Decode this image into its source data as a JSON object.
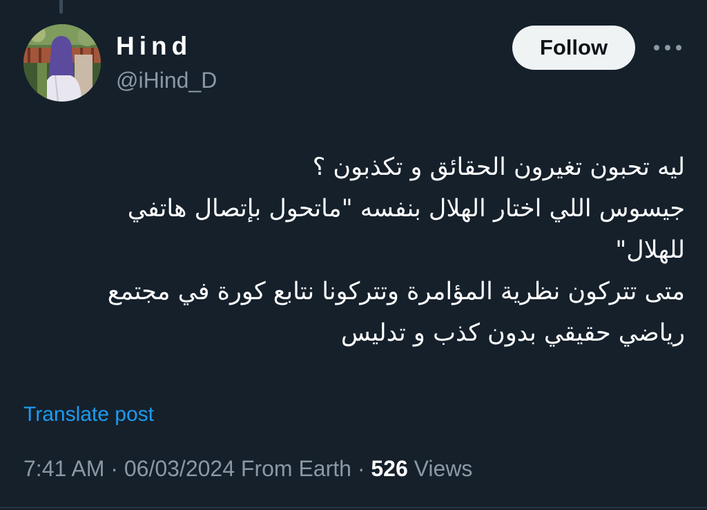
{
  "colors": {
    "background": "#15202b",
    "primary_text": "#ffffff",
    "secondary_text": "#8b98a5",
    "link": "#1d9bf0",
    "follow_button_bg": "#eff3f4",
    "follow_button_text": "#0f1419"
  },
  "author": {
    "display_name": "Hind",
    "handle": "@iHind_D",
    "avatar_icon": "profile-photo"
  },
  "actions": {
    "follow_label": "Follow",
    "more_icon": "more-horizontal-icon"
  },
  "post": {
    "lines": [
      "ليه تحبون تغيرون الحقائق و تكذبون ؟",
      "جيسوس اللي اختار الهلال بنفسه \"ماتحول بإتصال هاتفي",
      "للهلال\"",
      "متى تتركون نظرية المؤامرة وتتركونا نتابع كورة في مجتمع",
      "رياضي حقيقي بدون كذب و تدليس"
    ],
    "translate_label": "Translate post"
  },
  "meta": {
    "time": "7:41 AM",
    "separator": "·",
    "date": "06/03/2024",
    "source": "From Earth",
    "views_count": "526",
    "views_label": "Views"
  }
}
